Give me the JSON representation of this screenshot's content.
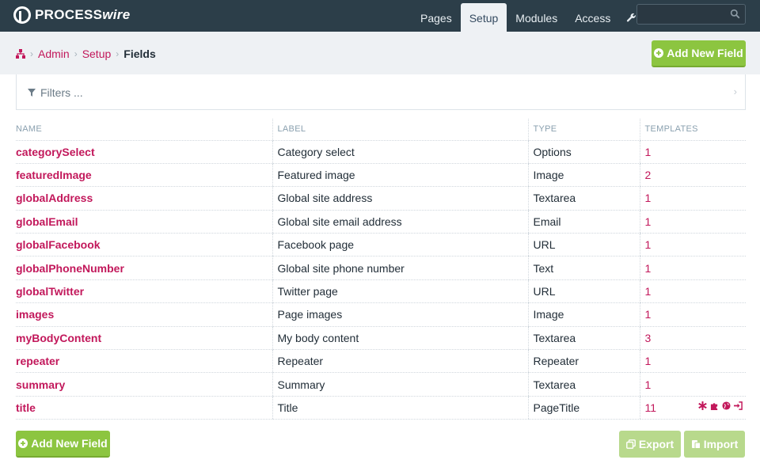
{
  "brand": {
    "logo_bold": "PROCESS",
    "logo_italic": "wire"
  },
  "nav": {
    "items": [
      {
        "label": "Pages",
        "active": false
      },
      {
        "label": "Setup",
        "active": true
      },
      {
        "label": "Modules",
        "active": false
      },
      {
        "label": "Access",
        "active": false
      }
    ],
    "search_placeholder": ""
  },
  "breadcrumb": {
    "links": [
      "Admin",
      "Setup"
    ],
    "current": "Fields"
  },
  "actions": {
    "add_new_field": "Add New Field",
    "export": "Export",
    "import": "Import"
  },
  "filters": {
    "label": "Filters ..."
  },
  "table": {
    "headers": {
      "name": "NAME",
      "label": "LABEL",
      "type": "TYPE",
      "templates": "TEMPLATES"
    },
    "rows": [
      {
        "name": "categorySelect",
        "label": "Category select",
        "type": "Options",
        "templates": "1"
      },
      {
        "name": "featuredImage",
        "label": "Featured image",
        "type": "Image",
        "templates": "2"
      },
      {
        "name": "globalAddress",
        "label": "Global site address",
        "type": "Textarea",
        "templates": "1"
      },
      {
        "name": "globalEmail",
        "label": "Global site email address",
        "type": "Email",
        "templates": "1"
      },
      {
        "name": "globalFacebook",
        "label": "Facebook page",
        "type": "URL",
        "templates": "1"
      },
      {
        "name": "globalPhoneNumber",
        "label": "Global site phone number",
        "type": "Text",
        "templates": "1"
      },
      {
        "name": "globalTwitter",
        "label": "Twitter page",
        "type": "URL",
        "templates": "1"
      },
      {
        "name": "images",
        "label": "Page images",
        "type": "Image",
        "templates": "1"
      },
      {
        "name": "myBodyContent",
        "label": "My body content",
        "type": "Textarea",
        "templates": "3"
      },
      {
        "name": "repeater",
        "label": "Repeater",
        "type": "Repeater",
        "templates": "1"
      },
      {
        "name": "summary",
        "label": "Summary",
        "type": "Textarea",
        "templates": "1"
      },
      {
        "name": "title",
        "label": "Title",
        "type": "PageTitle",
        "templates": "11",
        "flags": [
          "asterisk-icon",
          "puzzle-icon",
          "globe-icon",
          "sign-in-icon"
        ]
      }
    ]
  },
  "colors": {
    "topbar": "#2c3e49",
    "accent": "#c2185b",
    "button": "#8cc540",
    "button_faded": "#b8d98c",
    "header_bg": "#eef1f4"
  }
}
